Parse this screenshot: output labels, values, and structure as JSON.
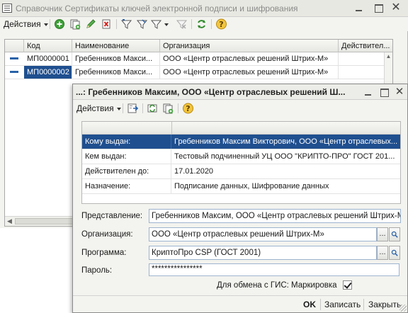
{
  "main_window": {
    "title": "Справочник Сертификаты ключей электронной подписи и шифрования",
    "toolbar": {
      "actions_label": "Действия"
    },
    "table": {
      "columns": [
        "Код",
        "Наименование",
        "Организация",
        "Действител..."
      ],
      "rows": [
        {
          "code": "МП0000001",
          "name": "Гребенников Макси...",
          "org": "ООО «Центр отраслевых решений Штрих-М»",
          "valid": ""
        },
        {
          "code": "МП0000002",
          "name": "Гребенников Макси...",
          "org": "ООО «Центр отраслевых решений Штрих-М»",
          "valid": ""
        }
      ]
    }
  },
  "dialog": {
    "title": "...: Гребенников Максим, ООО «Центр отраслевых решений Ш...",
    "toolbar": {
      "actions_label": "Действия"
    },
    "info": [
      {
        "key": "Кому выдан:",
        "value": "Гребенников Максим Викторович, ООО «Центр отраслевых..."
      },
      {
        "key": "Кем выдан:",
        "value": "Тестовый подчиненный УЦ ООО \"КРИПТО-ПРО\" ГОСТ 201..."
      },
      {
        "key": "Действителен до:",
        "value": "17.01.2020"
      },
      {
        "key": "Назначение:",
        "value": "Подписание данных, Шифрование данных"
      }
    ],
    "fields": {
      "representation_label": "Представление:",
      "representation_value": "Гребенников Максим, ООО «Центр отраслевых решений Штрих-М»,",
      "organization_label": "Организация:",
      "organization_value": "ООО «Центр отраслевых решений Штрих-М»",
      "program_label": "Программа:",
      "program_value": "КриптоПро CSP (ГОСТ 2001)",
      "password_label": "Пароль:",
      "password_value": "****************",
      "gis_label": "Для обмена с ГИС: Маркировка",
      "gis_checked": true,
      "select_button": "...",
      "open_button_icon": "magnifier-icon"
    },
    "buttons": {
      "ok": "OK",
      "save": "Записать",
      "close": "Закрыть"
    }
  },
  "colors": {
    "selection": "#1f4f8f",
    "field_border": "#9db4cf",
    "window_bg": "#f3f3ef"
  }
}
